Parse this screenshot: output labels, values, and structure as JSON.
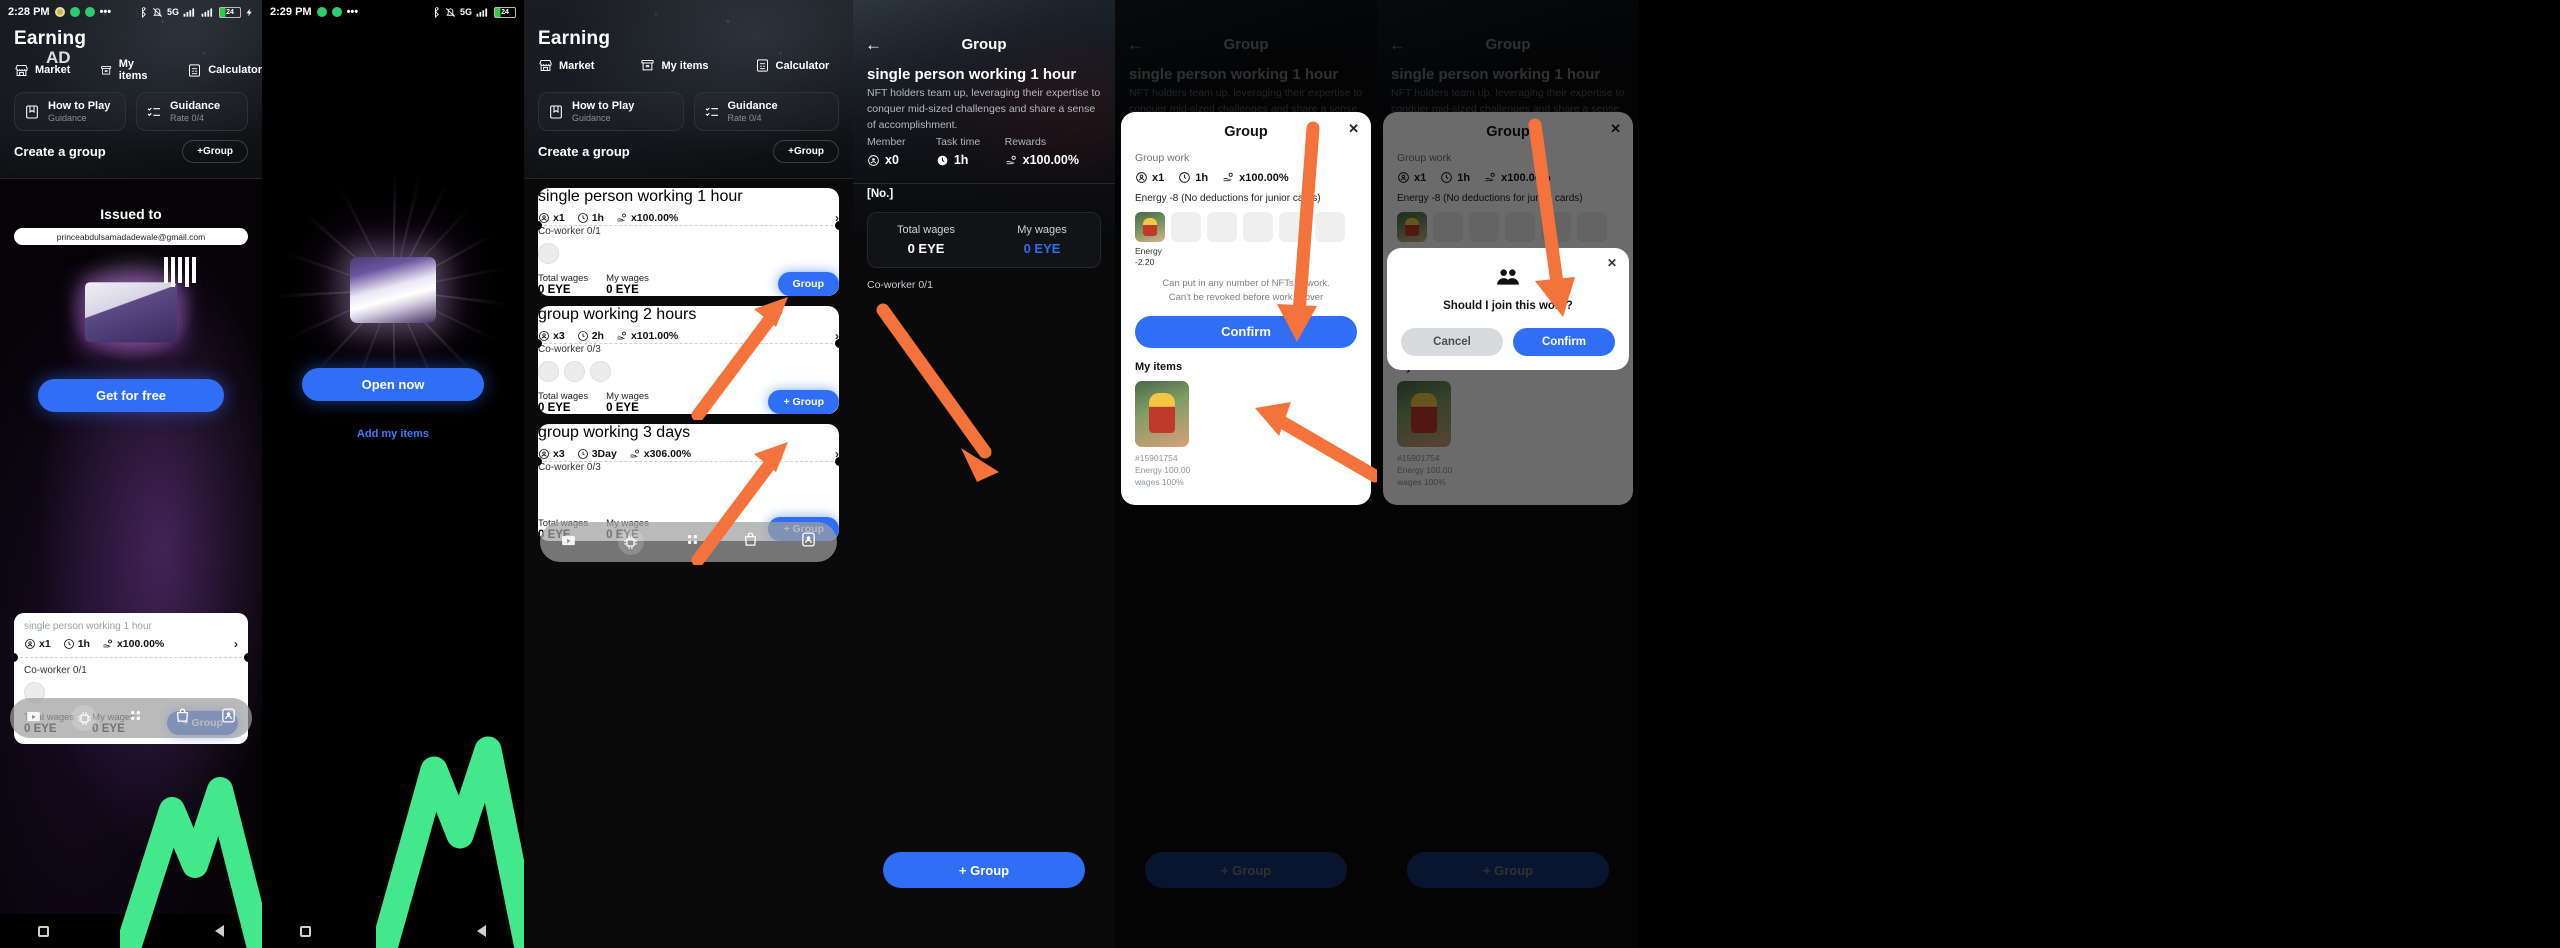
{
  "status_bar": {
    "time_p1": "2:28 PM",
    "time_p2": "2:29 PM",
    "network": "5G",
    "battery": "24",
    "overflow": "•••"
  },
  "earning": {
    "title": "Earning",
    "ad_badge": "AD",
    "nav": [
      {
        "label": "Market",
        "icon": "market-icon"
      },
      {
        "label": "My items",
        "icon": "box-icon"
      },
      {
        "label": "Calculator",
        "icon": "calculator-icon"
      }
    ],
    "cards": [
      {
        "title": "How to Play",
        "sub": "Guidance",
        "icon": "book-icon"
      },
      {
        "title": "Guidance",
        "sub": "Rate 0/4",
        "icon": "checklist-icon"
      }
    ],
    "section_label": "Create a group",
    "add_group_button": "+Group"
  },
  "ad": {
    "issued_to": "Issued to",
    "email": "princeabdulsamadadewale@gmail.com",
    "cta_get": "Get for free",
    "cta_open": "Open now",
    "add_my_items": "Add my items"
  },
  "group_list": [
    {
      "title": "single person working 1 hour",
      "members": "x1",
      "time": "1h",
      "rewards": "x100.00%",
      "coworker": "Co-worker 0/1",
      "total_wages_label": "Total wages",
      "total_wages_value": "0 EYE",
      "my_wages_label": "My wages",
      "my_wages_value": "0 EYE",
      "action": "Group"
    },
    {
      "title": "group working 2 hours",
      "members": "x3",
      "time": "2h",
      "rewards": "x101.00%",
      "coworker": "Co-worker 0/3",
      "total_wages_label": "Total wages",
      "total_wages_value": "0 EYE",
      "my_wages_label": "My wages",
      "my_wages_value": "0 EYE",
      "action": "+ Group"
    },
    {
      "title": "group working 3 days",
      "members": "x3",
      "time": "3Day",
      "rewards": "x306.00%",
      "coworker": "Co-worker 0/3",
      "total_wages_label": "Total wages",
      "total_wages_value": "0 EYE",
      "my_wages_label": "My wages",
      "my_wages_value": "0 EYE",
      "action": "+ Group"
    }
  ],
  "group_detail": {
    "header": "Group",
    "name": "single person working 1 hour",
    "description": "NFT holders team up, leveraging their expertise to conquer mid-sized challenges and share a sense of accomplishment.",
    "stats": [
      {
        "label": "Member",
        "value": "x0",
        "icon": "person-icon"
      },
      {
        "label": "Task time",
        "value": "1h",
        "icon": "clock-icon"
      },
      {
        "label": "Rewards",
        "value": "x100.00%",
        "icon": "hand-coin-icon"
      }
    ],
    "no_label": "[No.]",
    "total_wages_label": "Total wages",
    "total_wages_value": "0 EYE",
    "my_wages_label": "My wages",
    "my_wages_value": "0 EYE",
    "coworker": "Co-worker 0/1",
    "cta": "+ Group"
  },
  "group_modal": {
    "close": "✕",
    "title": "Group",
    "subtitle": "Group work",
    "members": "x1",
    "time": "1h",
    "rewards": "x100.00%",
    "energy_line": "Energy -8 (No deductions for junior cards)",
    "slot_energy_label": "Energy",
    "slot_energy_value": "-2.20",
    "note": "Can put in any number of NFTs to work.\nCan't be revoked before work is over",
    "confirm": "Confirm",
    "my_items": "My items",
    "nft_id": "#15901754",
    "nft_energy": "Energy 100.00",
    "nft_wages": "wages 100%"
  },
  "confirm_dialog": {
    "question": "Should I join this work?",
    "cancel": "Cancel",
    "confirm": "Confirm",
    "close": "✕",
    "icon": "group-people-icon"
  },
  "dock": {
    "items": [
      "store-icon",
      "chip-icon",
      "community-icon",
      "bag-icon",
      "profile-icon"
    ]
  },
  "android_nav": {
    "back": "back-triangle",
    "home": "home-circle",
    "recents": "recents-square"
  },
  "colors": {
    "accent_blue": "#2f6ef5",
    "arrow_orange": "#f4723b",
    "arrow_green": "#43e88c",
    "card_white": "#ffffff",
    "bg_black": "#000000"
  }
}
